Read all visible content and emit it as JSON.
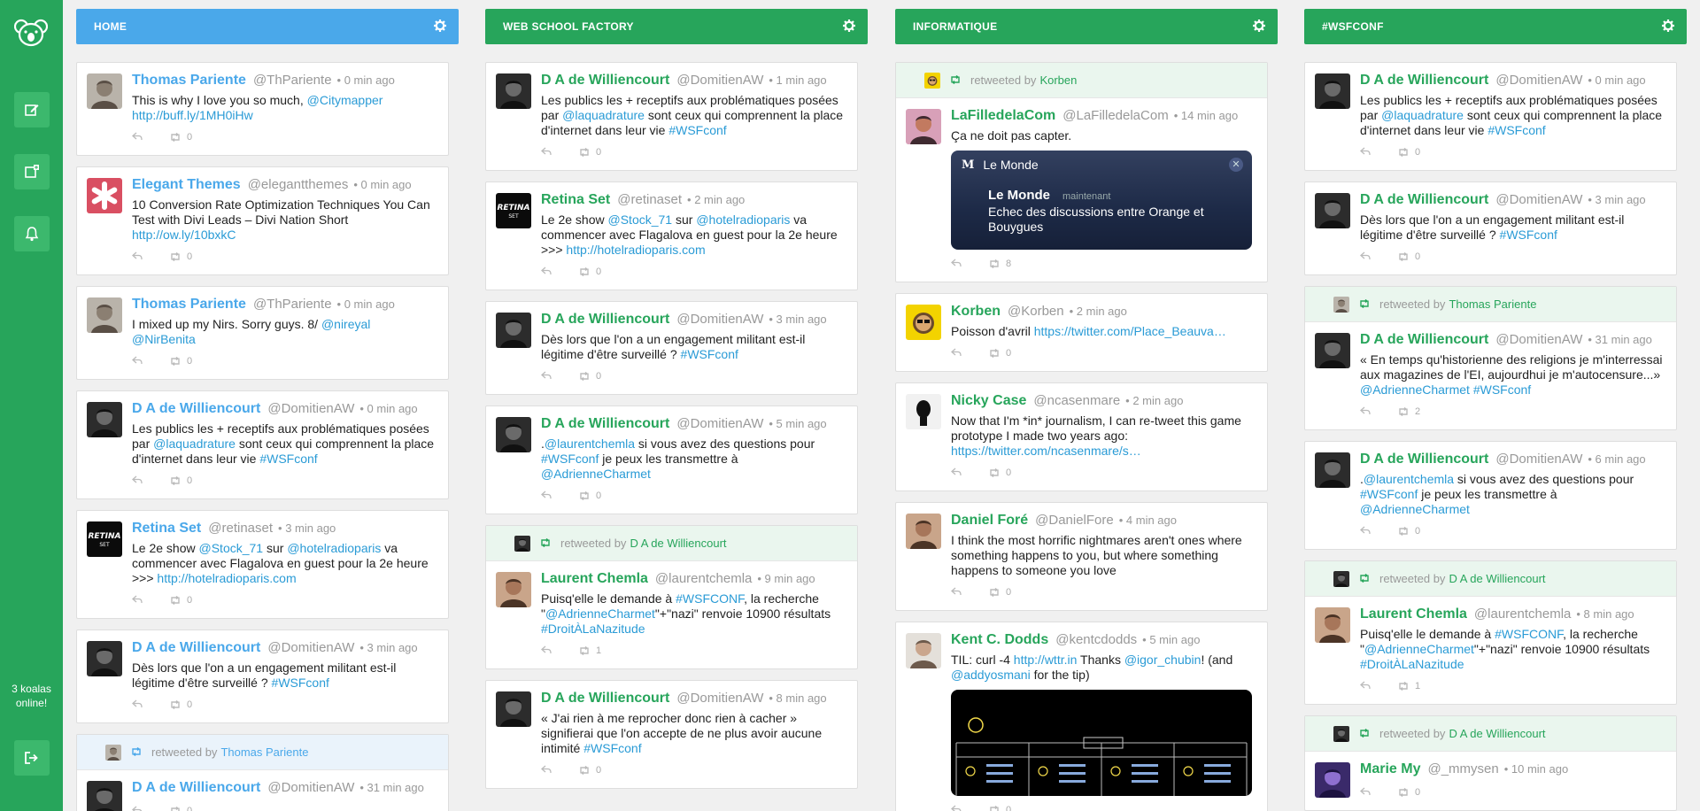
{
  "app": {
    "online_text": "3 koalas online!"
  },
  "columns": [
    {
      "id": "home",
      "title": "HOME",
      "header_color": "#4aa8ea",
      "name_color": "#4aa8ea",
      "tweets": [
        {
          "name": "Thomas Pariente",
          "handle": "@ThPariente",
          "time": "0 min ago",
          "text": [
            {
              "t": "This is why I love you so much, "
            },
            {
              "t": "@Citymapper",
              "lk": true
            },
            {
              "t": " "
            },
            {
              "t": "http://buff.ly/1MH0iHw",
              "lk": true
            }
          ],
          "rt": "0",
          "avatar": "face-grey"
        },
        {
          "name": "Elegant Themes",
          "handle": "@elegantthemes",
          "time": "0 min ago",
          "text": [
            {
              "t": "10 Conversion Rate Optimization Techniques You Can Test with Divi Leads – Divi Nation Short "
            },
            {
              "t": "http://ow.ly/10bxkC",
              "lk": true
            }
          ],
          "rt": "0",
          "avatar": "asterisk-red"
        },
        {
          "name": "Thomas Pariente",
          "handle": "@ThPariente",
          "time": "0 min ago",
          "text": [
            {
              "t": "I mixed up my Nirs. Sorry guys. 8/ "
            },
            {
              "t": "@nireyal",
              "lk": true
            },
            {
              "t": " "
            },
            {
              "t": "@NirBenita",
              "lk": true
            }
          ],
          "rt": "0",
          "avatar": "face-grey"
        },
        {
          "name": "D A de Williencourt",
          "handle": "@DomitienAW",
          "time": "0 min ago",
          "text": [
            {
              "t": "Les publics les + receptifs aux problématiques posées par "
            },
            {
              "t": "@laquadrature",
              "lk": true
            },
            {
              "t": " sont ceux qui comprennent la place d'internet dans leur vie "
            },
            {
              "t": "#WSFconf",
              "lk": true
            }
          ],
          "rt": "0",
          "avatar": "face-dark"
        },
        {
          "name": "Retina Set",
          "handle": "@retinaset",
          "time": "3 min ago",
          "text": [
            {
              "t": "Le 2e show "
            },
            {
              "t": "@Stock_71",
              "lk": true
            },
            {
              "t": " sur "
            },
            {
              "t": "@hotelradioparis",
              "lk": true
            },
            {
              "t": " va commencer avec Flagalova en guest pour la 2e heure >>> "
            },
            {
              "t": "http://hotelradioparis.com",
              "lk": true
            }
          ],
          "rt": "0",
          "avatar": "retina"
        },
        {
          "name": "D A de Williencourt",
          "handle": "@DomitienAW",
          "time": "3 min ago",
          "text": [
            {
              "t": "Dès lors que l'on a un engagement militant est-il légitime d'être surveillé ? "
            },
            {
              "t": "#WSFconf",
              "lk": true
            }
          ],
          "rt": "0",
          "avatar": "face-dark"
        },
        {
          "retweeted_by": "Thomas Pariente",
          "name": "D A de Williencourt",
          "handle": "@DomitienAW",
          "time": "31 min ago",
          "text": [
            {
              "t": ""
            }
          ],
          "rt": "0",
          "avatar": "face-dark",
          "rt_avatar": "face-grey"
        }
      ]
    },
    {
      "id": "wsf",
      "title": "WEB SCHOOL FACTORY",
      "header_color": "#27a55b",
      "name_color": "#27a55b",
      "tweets": [
        {
          "name": "D A de Williencourt",
          "handle": "@DomitienAW",
          "time": "1 min ago",
          "text": [
            {
              "t": "Les publics les + receptifs aux problématiques posées par "
            },
            {
              "t": "@laquadrature",
              "lk": true
            },
            {
              "t": " sont ceux qui comprennent la place d'internet dans leur vie "
            },
            {
              "t": "#WSFconf",
              "lk": true
            }
          ],
          "rt": "0",
          "avatar": "face-dark"
        },
        {
          "name": "Retina Set",
          "handle": "@retinaset",
          "time": "2 min ago",
          "text": [
            {
              "t": "Le 2e show "
            },
            {
              "t": "@Stock_71",
              "lk": true
            },
            {
              "t": " sur "
            },
            {
              "t": "@hotelradioparis",
              "lk": true
            },
            {
              "t": " va commencer avec Flagalova en guest pour la 2e heure >>> "
            },
            {
              "t": "http://hotelradioparis.com",
              "lk": true
            }
          ],
          "rt": "0",
          "avatar": "retina"
        },
        {
          "name": "D A de Williencourt",
          "handle": "@DomitienAW",
          "time": "3 min ago",
          "text": [
            {
              "t": "Dès lors que l'on a un engagement militant est-il légitime d'être surveillé ? "
            },
            {
              "t": "#WSFconf",
              "lk": true
            }
          ],
          "rt": "0",
          "avatar": "face-dark"
        },
        {
          "name": "D A de Williencourt",
          "handle": "@DomitienAW",
          "time": "5 min ago",
          "text": [
            {
              "t": "."
            },
            {
              "t": "@laurentchemla",
              "lk": true
            },
            {
              "t": " si vous avez des questions pour "
            },
            {
              "t": "#WSFconf",
              "lk": true
            },
            {
              "t": " je peux les transmettre à "
            },
            {
              "t": "@AdrienneCharmet",
              "lk": true
            }
          ],
          "rt": "0",
          "avatar": "face-dark"
        },
        {
          "retweeted_by": "D A de Williencourt",
          "name": "Laurent Chemla",
          "handle": "@laurentchemla",
          "time": "9 min ago",
          "text": [
            {
              "t": "Puisq'elle le demande à "
            },
            {
              "t": "#WSFCONF",
              "lk": true
            },
            {
              "t": ", la recherche \""
            },
            {
              "t": "@AdrienneCharmet",
              "lk": true
            },
            {
              "t": "\"+\"nazi\" renvoie 10900 résultats "
            },
            {
              "t": "#DroitÀLaNazitude",
              "lk": true
            }
          ],
          "rt": "1",
          "avatar": "face-warm",
          "rt_avatar": "face-dark"
        },
        {
          "name": "D A de Williencourt",
          "handle": "@DomitienAW",
          "time": "8 min ago",
          "text": [
            {
              "t": "« J'ai rien à me reprocher donc rien à cacher » signifierai que l'on accepte de ne plus avoir aucune intimité "
            },
            {
              "t": "#WSFconf",
              "lk": true
            }
          ],
          "rt": "0",
          "avatar": "face-dark"
        }
      ]
    },
    {
      "id": "info",
      "title": "INFORMATIQUE",
      "header_color": "#27a55b",
      "name_color": "#27a55b",
      "tweets": [
        {
          "retweeted_by": "Korben",
          "name": "LaFilledelaCom",
          "handle": "@LaFilledelaCom",
          "time": "14 min ago",
          "text": [
            {
              "t": "Ça ne doit pas capter."
            }
          ],
          "rt": "8",
          "avatar": "face-pink",
          "rt_avatar": "korben",
          "card": {
            "app": "Le Monde",
            "source": "Le Monde",
            "when": "maintenant",
            "body": "Echec des discussions entre Orange et Bouygues"
          }
        },
        {
          "name": "Korben",
          "handle": "@Korben",
          "time": "2 min ago",
          "text": [
            {
              "t": "Poisson d'avril "
            },
            {
              "t": "https://twitter.com/Place_Beauva…",
              "lk": true
            }
          ],
          "rt": "0",
          "avatar": "korben"
        },
        {
          "name": "Nicky Case",
          "handle": "@ncasenmare",
          "time": "2 min ago",
          "text": [
            {
              "t": "Now that I'm *in* journalism, I can re-tweet this game prototype I made two years ago: "
            },
            {
              "t": "https://twitter.com/ncasenmare/s…",
              "lk": true
            }
          ],
          "rt": "0",
          "avatar": "nicky"
        },
        {
          "name": "Daniel Foré",
          "handle": "@DanielFore",
          "time": "4 min ago",
          "text": [
            {
              "t": "I think the most horrific nightmares aren't ones where something happens to you, but where something happens to someone you love"
            }
          ],
          "rt": "0",
          "avatar": "face-warm"
        },
        {
          "name": "Kent C. Dodds",
          "handle": "@kentcdodds",
          "time": "5 min ago",
          "text": [
            {
              "t": "TIL: curl -4 "
            },
            {
              "t": "http://wttr.in",
              "lk": true
            },
            {
              "t": " Thanks "
            },
            {
              "t": "@igor_chubin",
              "lk": true
            },
            {
              "t": "! (and "
            },
            {
              "t": "@addyosmani",
              "lk": true
            },
            {
              "t": " for the tip)"
            }
          ],
          "rt": "0",
          "avatar": "face-light",
          "weather": true
        }
      ]
    },
    {
      "id": "wsfconf",
      "title": "#WSFCONF",
      "header_color": "#27a55b",
      "name_color": "#27a55b",
      "tweets": [
        {
          "name": "D A de Williencourt",
          "handle": "@DomitienAW",
          "time": "0 min ago",
          "text": [
            {
              "t": "Les publics les + receptifs aux problématiques posées par "
            },
            {
              "t": "@laquadrature",
              "lk": true
            },
            {
              "t": " sont ceux qui comprennent la place d'internet dans leur vie "
            },
            {
              "t": "#WSFconf",
              "lk": true
            }
          ],
          "rt": "0",
          "avatar": "face-dark"
        },
        {
          "name": "D A de Williencourt",
          "handle": "@DomitienAW",
          "time": "3 min ago",
          "text": [
            {
              "t": "Dès lors que l'on a un engagement militant est-il légitime d'être surveillé ? "
            },
            {
              "t": "#WSFconf",
              "lk": true
            }
          ],
          "rt": "0",
          "avatar": "face-dark"
        },
        {
          "retweeted_by": "Thomas Pariente",
          "name": "D A de Williencourt",
          "handle": "@DomitienAW",
          "time": "31 min ago",
          "text": [
            {
              "t": "« En temps qu'historienne des religions je m'interressai aux magazines de l'EI, aujourdhui je m'autocensure...» "
            },
            {
              "t": "@AdrienneCharmet",
              "lk": true
            },
            {
              "t": " "
            },
            {
              "t": "#WSFconf",
              "lk": true
            }
          ],
          "rt": "2",
          "avatar": "face-dark",
          "rt_avatar": "face-grey"
        },
        {
          "name": "D A de Williencourt",
          "handle": "@DomitienAW",
          "time": "6 min ago",
          "text": [
            {
              "t": "."
            },
            {
              "t": "@laurentchemla",
              "lk": true
            },
            {
              "t": " si vous avez des questions pour "
            },
            {
              "t": "#WSFconf",
              "lk": true
            },
            {
              "t": " je peux les transmettre à "
            },
            {
              "t": "@AdrienneCharmet",
              "lk": true
            }
          ],
          "rt": "0",
          "avatar": "face-dark"
        },
        {
          "retweeted_by": "D A de Williencourt",
          "name": "Laurent Chemla",
          "handle": "@laurentchemla",
          "time": "8 min ago",
          "text": [
            {
              "t": "Puisq'elle le demande à "
            },
            {
              "t": "#WSFCONF",
              "lk": true
            },
            {
              "t": ", la recherche \""
            },
            {
              "t": "@AdrienneCharmet",
              "lk": true
            },
            {
              "t": "\"+\"nazi\" renvoie 10900 résultats "
            },
            {
              "t": "#DroitÀLaNazitude",
              "lk": true
            }
          ],
          "rt": "1",
          "avatar": "face-warm",
          "rt_avatar": "face-dark"
        },
        {
          "retweeted_by": "D A de Williencourt",
          "name": "Marie My",
          "handle": "@_mmysen",
          "time": "10 min ago",
          "text": [
            {
              "t": ""
            }
          ],
          "rt": "0",
          "avatar": "face-purple",
          "rt_avatar": "face-dark"
        }
      ]
    }
  ],
  "labels": {
    "retweeted_by": "retweeted by"
  },
  "icons": {
    "logo": "koala-logo-icon",
    "compose": "compose-icon",
    "add_column": "add-column-icon",
    "notifications": "bell-icon",
    "logout": "logout-icon",
    "settings": "gear-icon",
    "reply": "reply-icon",
    "retweet": "retweet-icon"
  }
}
